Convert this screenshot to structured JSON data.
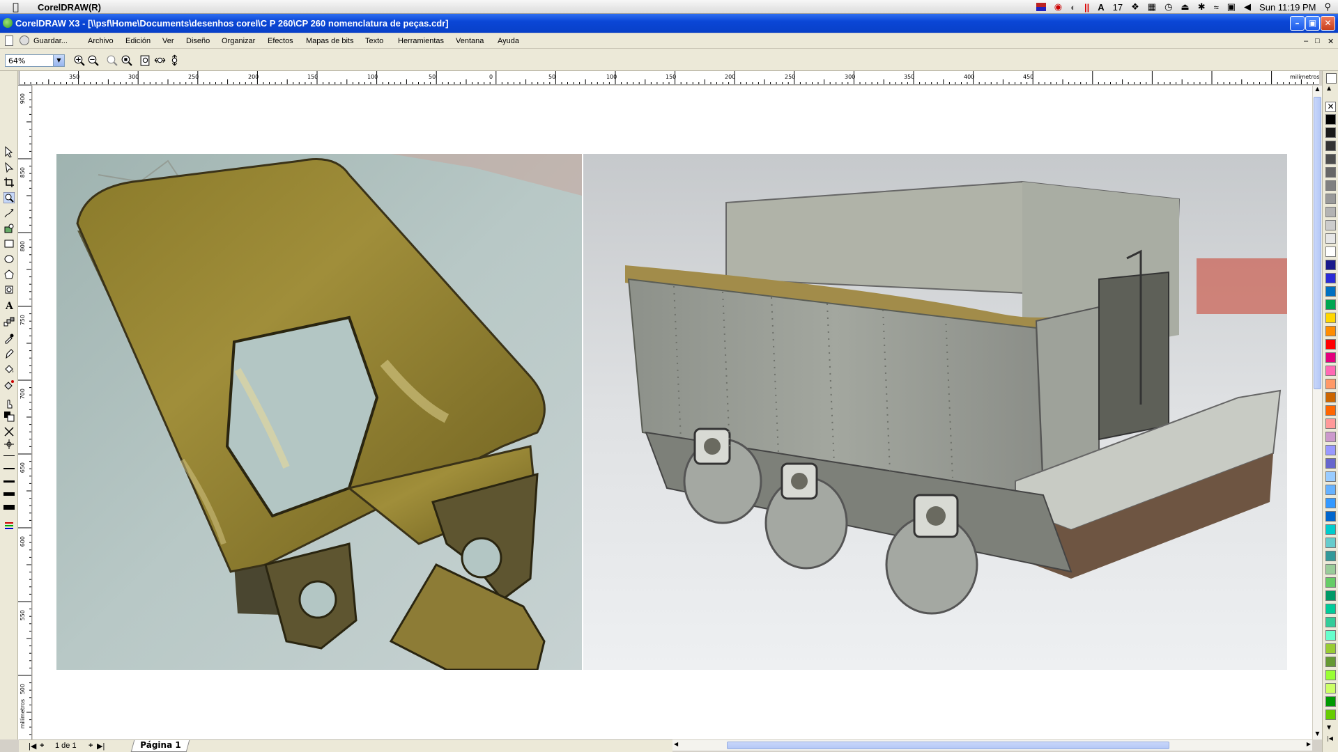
{
  "macos": {
    "app_name": "CorelDRAW(R)",
    "clock": "Sun 11:19 PM",
    "tray_number": "17"
  },
  "window": {
    "title": "CorelDRAW X3 - [\\\\psf\\Home\\Documents\\desenhos corel\\C P 260\\CP 260 nomenclatura de peças.cdr]"
  },
  "menu": {
    "save_label": "Guardar...",
    "items": [
      "Archivo",
      "Edición",
      "Ver",
      "Diseño",
      "Organizar",
      "Efectos",
      "Mapas de bits",
      "Texto",
      "Herramientas",
      "Ventana",
      "Ayuda"
    ]
  },
  "toolbar": {
    "zoom_value": "64%"
  },
  "rulers": {
    "unit": "milímetros",
    "h_ticks": [
      "350",
      "300",
      "250",
      "200",
      "150",
      "100",
      "50",
      "0",
      "50",
      "100",
      "150",
      "200",
      "250",
      "300",
      "350",
      "400",
      "450"
    ],
    "v_ticks": [
      "900",
      "850",
      "800",
      "750",
      "700",
      "650",
      "600",
      "550",
      "500"
    ]
  },
  "page_nav": {
    "counter": "1 de 1",
    "page_tab": "Página 1"
  },
  "palette": {
    "colors": [
      "#000000",
      "#1a1a1a",
      "#333333",
      "#4d4d4d",
      "#666666",
      "#808080",
      "#999999",
      "#b3b3b3",
      "#cccccc",
      "#e6e6e6",
      "#ffffff",
      "#1a1a8c",
      "#2b2bd6",
      "#0070c0",
      "#00a650",
      "#ffd700",
      "#ff8c00",
      "#ff0000",
      "#e4007c",
      "#ff69b4",
      "#ff9966",
      "#cc6600",
      "#ff6600",
      "#ff9999",
      "#cc99cc",
      "#9999ff",
      "#6666cc",
      "#99ccff",
      "#66b2ff",
      "#3399ff",
      "#0066cc",
      "#00cccc",
      "#66cccc",
      "#339999",
      "#99cc99",
      "#66cc66",
      "#009966",
      "#00cc99",
      "#33cc99",
      "#66ffcc",
      "#99cc33",
      "#669933",
      "#99ff33",
      "#ccff66",
      "#009900",
      "#66cc00"
    ]
  },
  "images": {
    "left_alt": "brass tender coal-bunker shell",
    "right_alt": "assembled model locomotive tender"
  }
}
